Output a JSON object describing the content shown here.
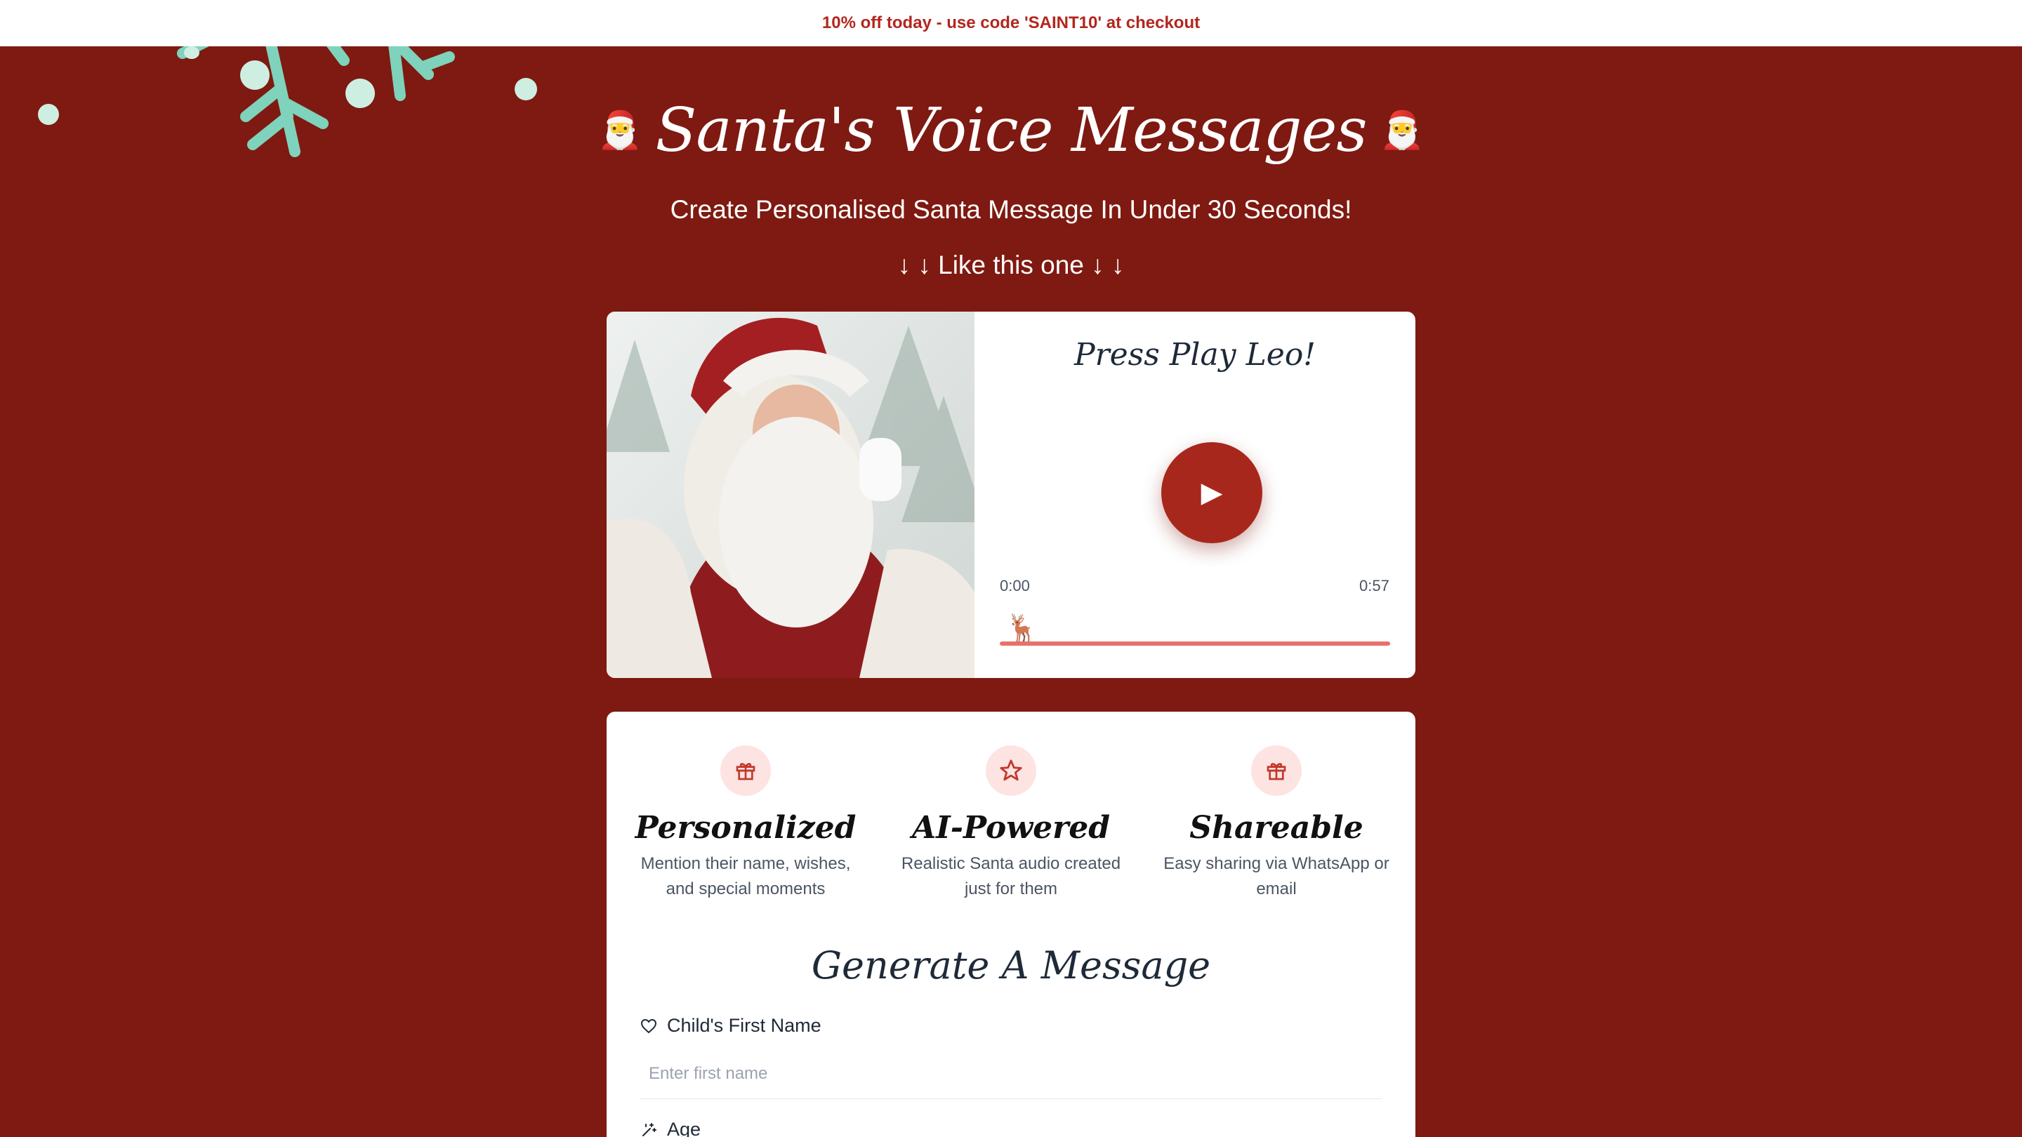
{
  "promo": {
    "text": "10% off today - use code 'SAINT10' at checkout"
  },
  "hero": {
    "title": "Santa's Voice Messages",
    "emoji": "🎅",
    "subtitle": "Create Personalised Santa Message In Under 30 Seconds!",
    "like_this": "↓ ↓ Like this one ↓ ↓"
  },
  "player": {
    "heading": "Press Play Leo!",
    "play_icon": "▶",
    "time_current": "0:00",
    "time_total": "0:57",
    "progress": 0.0,
    "reindeer_icon": "🦌"
  },
  "features": [
    {
      "icon": "gift-icon",
      "title": "Personalized",
      "desc": "Mention their name, wishes, and special moments"
    },
    {
      "icon": "star-icon",
      "title": "AI-Powered",
      "desc": "Realistic Santa audio created just for them"
    },
    {
      "icon": "gift-icon",
      "title": "Shareable",
      "desc": "Easy sharing via WhatsApp or email"
    }
  ],
  "form": {
    "title": "Generate A Message",
    "name_label": "Child's First Name",
    "name_placeholder": "Enter first name",
    "age_label": "Age"
  },
  "colors": {
    "background": "#7e1a11",
    "accent": "#a8271c",
    "promo_text": "#b3261e",
    "snowflake": "#7fd2bb",
    "icon_bg": "#fde3e1"
  }
}
